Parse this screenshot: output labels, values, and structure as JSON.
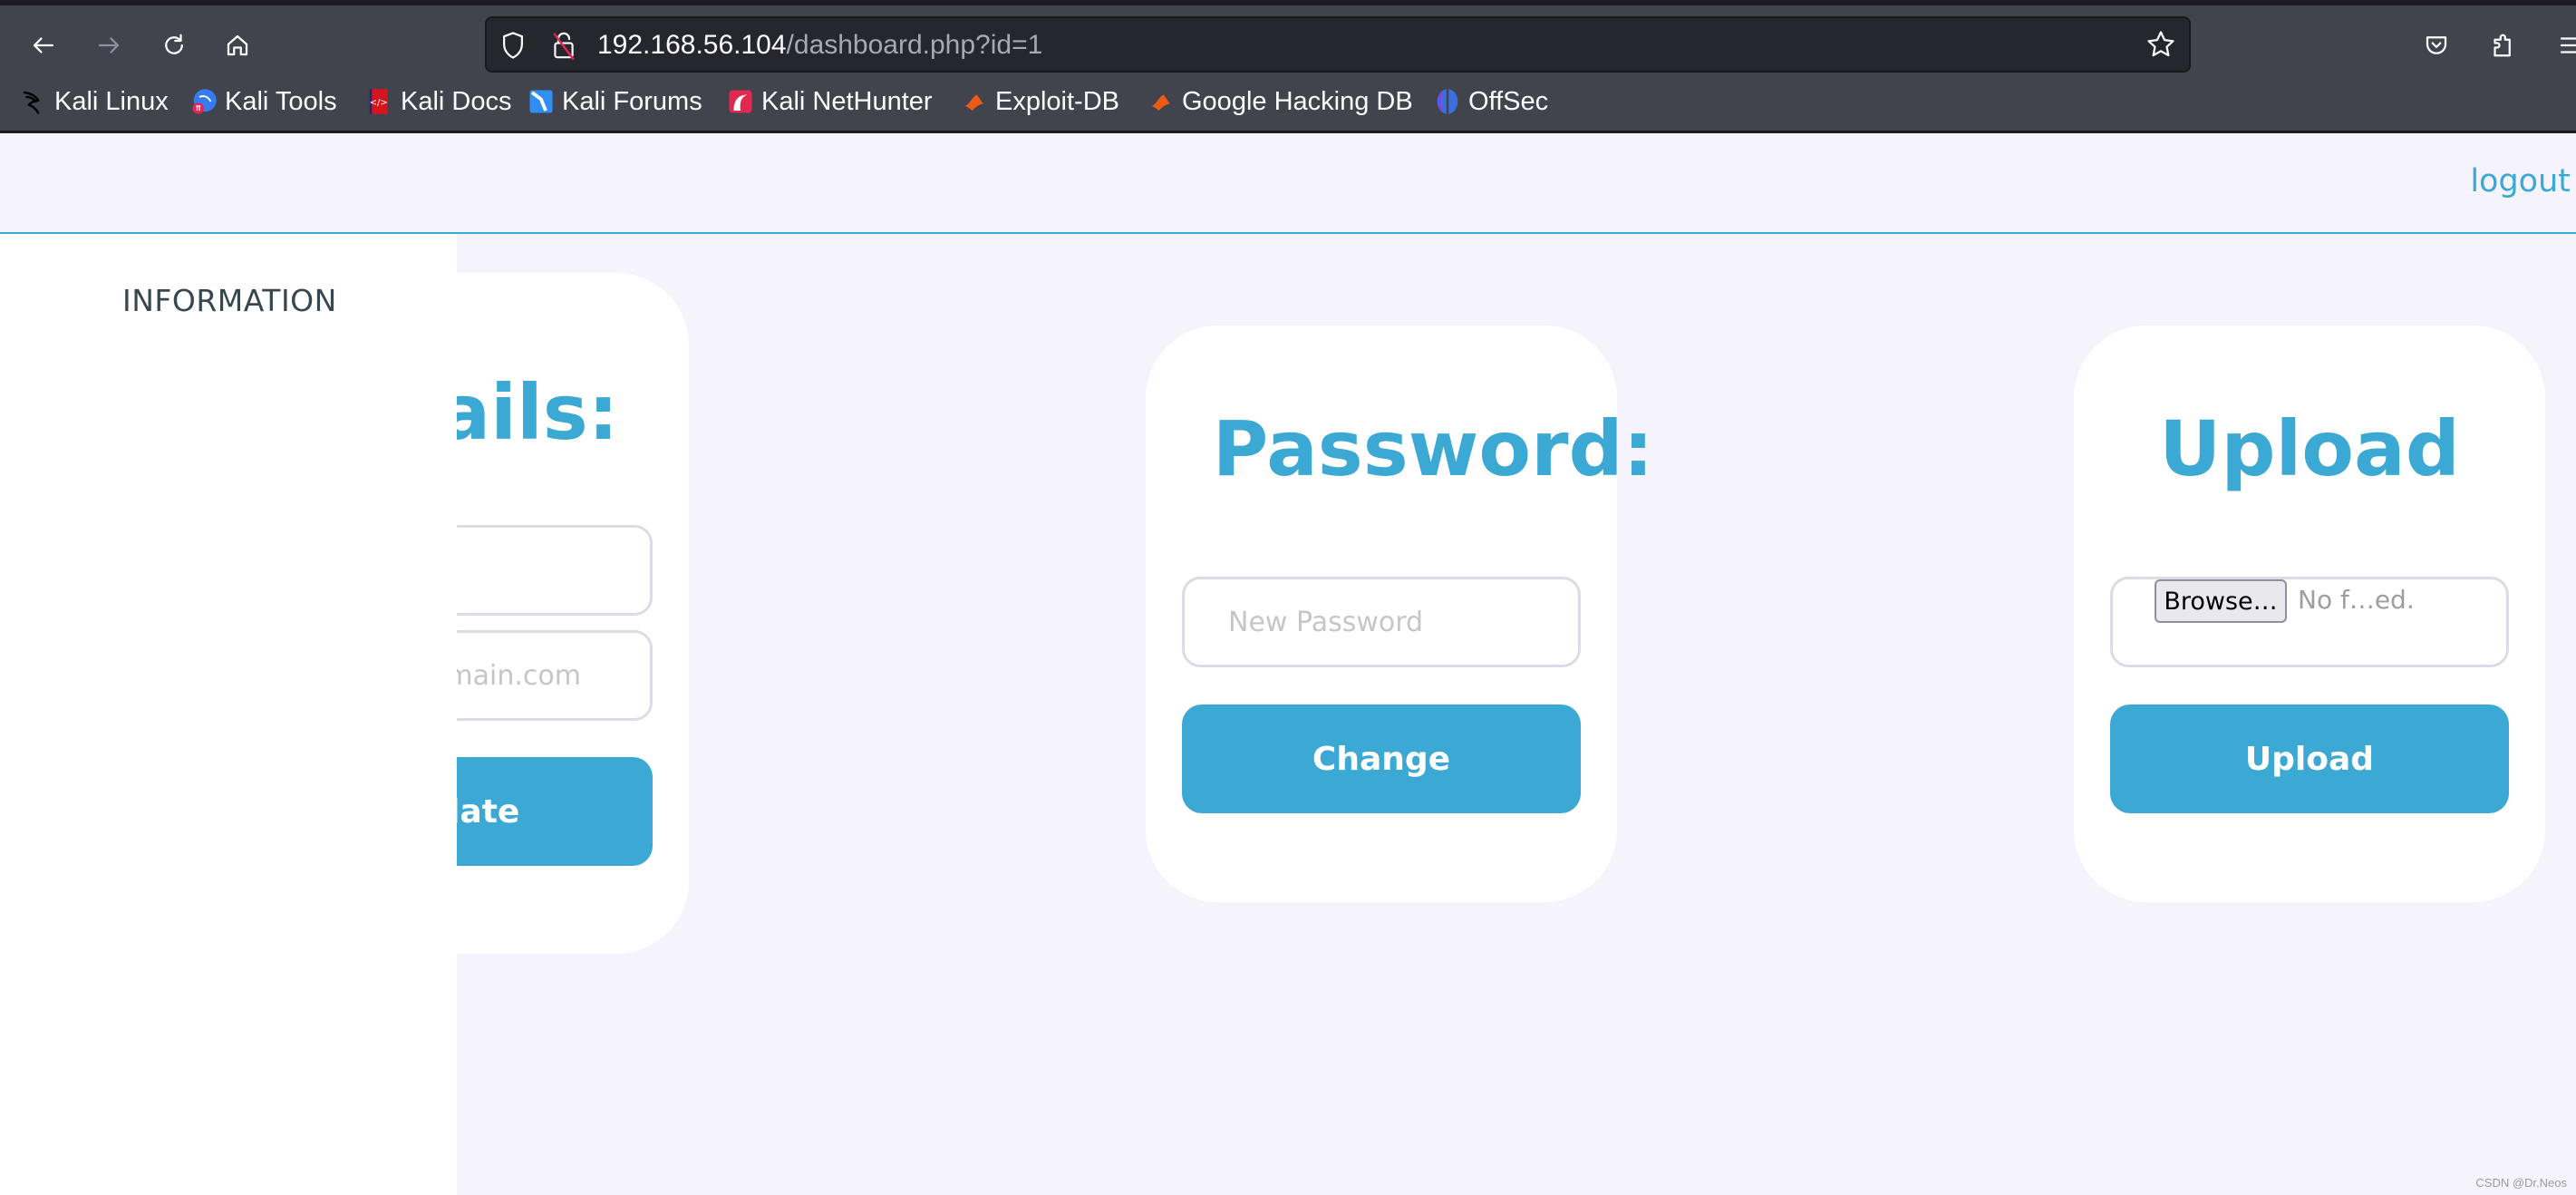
{
  "browser": {
    "url_host": "192.168.56.104",
    "url_path": "/dashboard.php?id=1",
    "nav": {
      "back_icon": "arrow-left-icon",
      "forward_icon": "arrow-right-icon",
      "reload_icon": "reload-icon",
      "home_icon": "home-icon"
    },
    "toolbar_icons": [
      "shield-icon",
      "insecure-lock-icon",
      "star-icon",
      "pocket-icon",
      "extensions-icon",
      "menu-icon"
    ],
    "bookmarks": [
      {
        "label": "Kali Linux",
        "icon": "kali-dragon-icon"
      },
      {
        "label": "Kali Tools",
        "icon": "kali-tools-icon"
      },
      {
        "label": "Kali Docs",
        "icon": "kali-docs-icon"
      },
      {
        "label": "Kali Forums",
        "icon": "kali-forums-icon"
      },
      {
        "label": "Kali NetHunter",
        "icon": "kali-nethunter-icon"
      },
      {
        "label": "Exploit-DB",
        "icon": "exploit-db-icon"
      },
      {
        "label": "Google Hacking DB",
        "icon": "ghdb-icon"
      },
      {
        "label": "OffSec",
        "icon": "offsec-icon"
      }
    ]
  },
  "header": {
    "logout_label": "logout"
  },
  "sidebar": {
    "title": "INFORMATION"
  },
  "cards": {
    "details": {
      "title": "Details:",
      "username_placeholder": "",
      "email_placeholder": "admin@domain.com",
      "button_label": "Update"
    },
    "password": {
      "title": "Password:",
      "new_password_placeholder": "New Password",
      "button_label": "Change"
    },
    "upload": {
      "title": "Upload",
      "browse_label": "Browse…",
      "file_status": "No f…ed.",
      "button_label": "Upload"
    }
  },
  "colors": {
    "accent": "#3ca8d4",
    "page_bg": "#f5f4fd",
    "sidebar_text": "#37474f"
  },
  "watermark": "CSDN @Dr.Neos"
}
